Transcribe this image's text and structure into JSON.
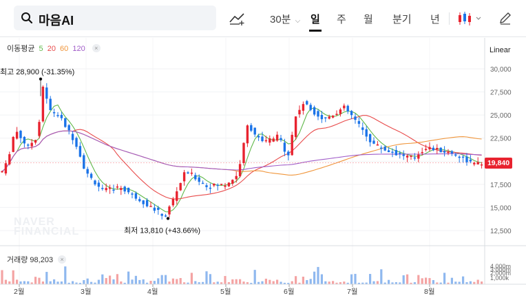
{
  "search": {
    "query": "마음AI"
  },
  "toolbar": {
    "interval": "30분",
    "periods": [
      "일",
      "주",
      "월",
      "분기",
      "년"
    ],
    "active_period": "일"
  },
  "legend": {
    "ma_title": "이동평균",
    "ma_periods": [
      {
        "label": "5",
        "color": "#5fb84a"
      },
      {
        "label": "20",
        "color": "#e84a4a"
      },
      {
        "label": "60",
        "color": "#f0953a"
      },
      {
        "label": "120",
        "color": "#a05cc8"
      }
    ],
    "volume_label": "거래량 98,203"
  },
  "scale_label": "Linear",
  "current_price": "19,840",
  "annotations": {
    "high": "최고 28,900 (-31.35%)",
    "low": "최저 13,810 (+43.66%)"
  },
  "watermark": [
    "NAVER",
    "FINANCIAL"
  ],
  "colors": {
    "up": "#e8232f",
    "down": "#1a73e8",
    "volume_up": "#f4a3a3",
    "volume_down": "#8fb8ef"
  },
  "chart_data": {
    "type": "candlestick",
    "y_ticks": [
      "30,000",
      "27,500",
      "25,000",
      "22,500",
      "20,000",
      "17,500",
      "15,000",
      "12,500"
    ],
    "y_tick_values": [
      30000,
      27500,
      25000,
      22500,
      20000,
      17500,
      15000,
      12500
    ],
    "x_ticks": [
      "2월",
      "3월",
      "4월",
      "5월",
      "6월",
      "7월",
      "8월"
    ],
    "volume_ticks": [
      "4,000m",
      "3,000m",
      "2,000m",
      "1,000k"
    ],
    "high": 28900,
    "low": 13810,
    "last_close": 19840
  }
}
